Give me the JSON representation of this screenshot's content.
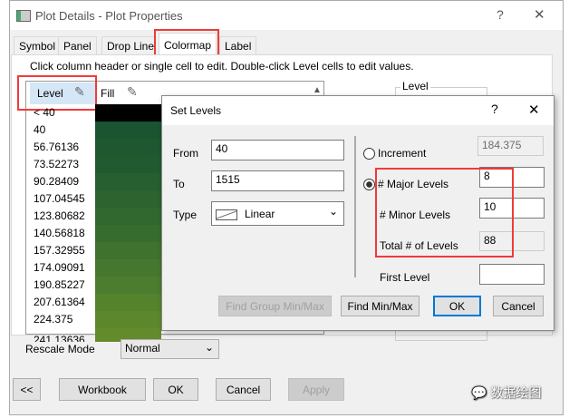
{
  "window": {
    "title": "Plot Details - Plot Properties",
    "help": "?",
    "close": "✕"
  },
  "tabs": [
    "Symbol",
    "Panel",
    "Drop Line",
    "Colormap",
    "Label"
  ],
  "instruction": "Click column header or single cell to edit. Double-click Level cells to edit values.",
  "table": {
    "headers": [
      "Level",
      "Fill"
    ],
    "rows": [
      {
        "level": "< 40",
        "color": "#000000"
      },
      {
        "level": "40",
        "color": "#1a5430"
      },
      {
        "level": "56.76136",
        "color": "#1e5730"
      },
      {
        "level": "73.52273",
        "color": "#225a30"
      },
      {
        "level": "90.28409",
        "color": "#275f30"
      },
      {
        "level": "107.04545",
        "color": "#2c632f"
      },
      {
        "level": "123.80682",
        "color": "#31682f"
      },
      {
        "level": "140.56818",
        "color": "#376c2f"
      },
      {
        "level": "157.32955",
        "color": "#3e722e"
      },
      {
        "level": "174.09091",
        "color": "#45772e"
      },
      {
        "level": "190.85227",
        "color": "#4c7c2d"
      },
      {
        "level": "207.61364",
        "color": "#54822d"
      },
      {
        "level": "224.375",
        "color": "#5c872c"
      },
      {
        "level": "241.13636",
        "color": "#648b2b"
      }
    ]
  },
  "level_group": "Level",
  "rescale": {
    "label": "Rescale Mode",
    "value": "Normal"
  },
  "bottom_buttons": {
    "back": "<<",
    "workbook": "Workbook",
    "ok": "OK",
    "cancel": "Cancel",
    "apply": "Apply"
  },
  "set_levels": {
    "title": "Set Levels",
    "help": "?",
    "close": "✕",
    "from_label": "From",
    "from": "40",
    "to_label": "To",
    "to": "1515",
    "type_label": "Type",
    "type": "Linear",
    "increment_label": "Increment",
    "increment": "184.375",
    "major_label": "# Major Levels",
    "major": "8",
    "minor_label": "# Minor Levels",
    "minor": "10",
    "total_label": "Total # of Levels",
    "total": "88",
    "first_label": "First Level",
    "first": "",
    "find_group": "Find Group Min/Max",
    "find": "Find Min/Max",
    "ok": "OK",
    "cancel": "Cancel"
  },
  "watermark": "数据绘图"
}
